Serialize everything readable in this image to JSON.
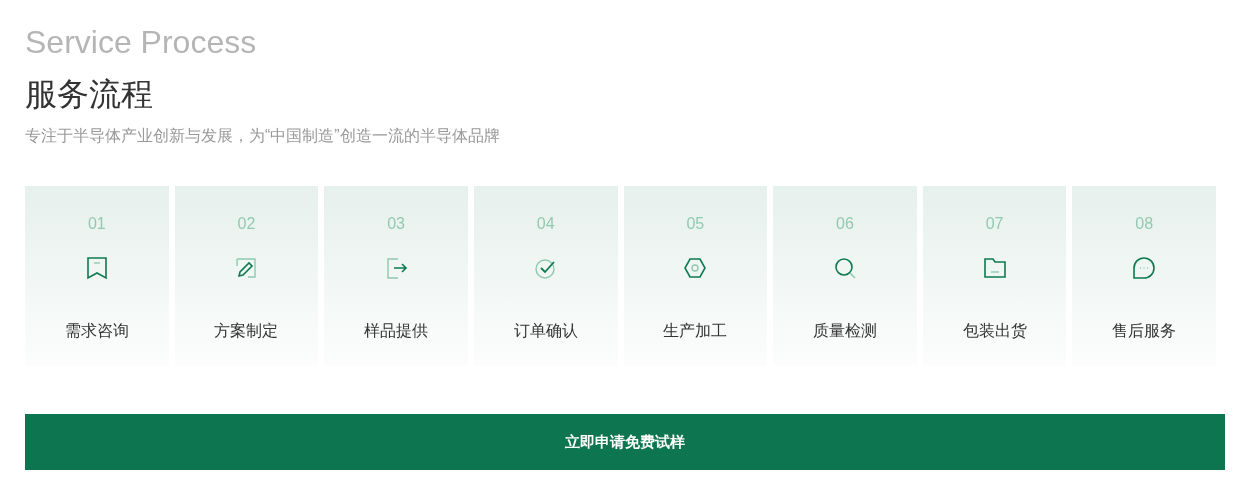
{
  "heading": {
    "english": "Service Process",
    "title": "服务流程",
    "subtitle": "专注于半导体产业创新与发展，为“中国制造”创造一流的半导体品牌"
  },
  "steps": [
    {
      "number": "01",
      "label": "需求咨询"
    },
    {
      "number": "02",
      "label": "方案制定"
    },
    {
      "number": "03",
      "label": "样品提供"
    },
    {
      "number": "04",
      "label": "订单确认"
    },
    {
      "number": "05",
      "label": "生产加工"
    },
    {
      "number": "06",
      "label": "质量检测"
    },
    {
      "number": "07",
      "label": "包装出货"
    },
    {
      "number": "08",
      "label": "售后服务"
    }
  ],
  "cta_button": "立即申请免费试样"
}
